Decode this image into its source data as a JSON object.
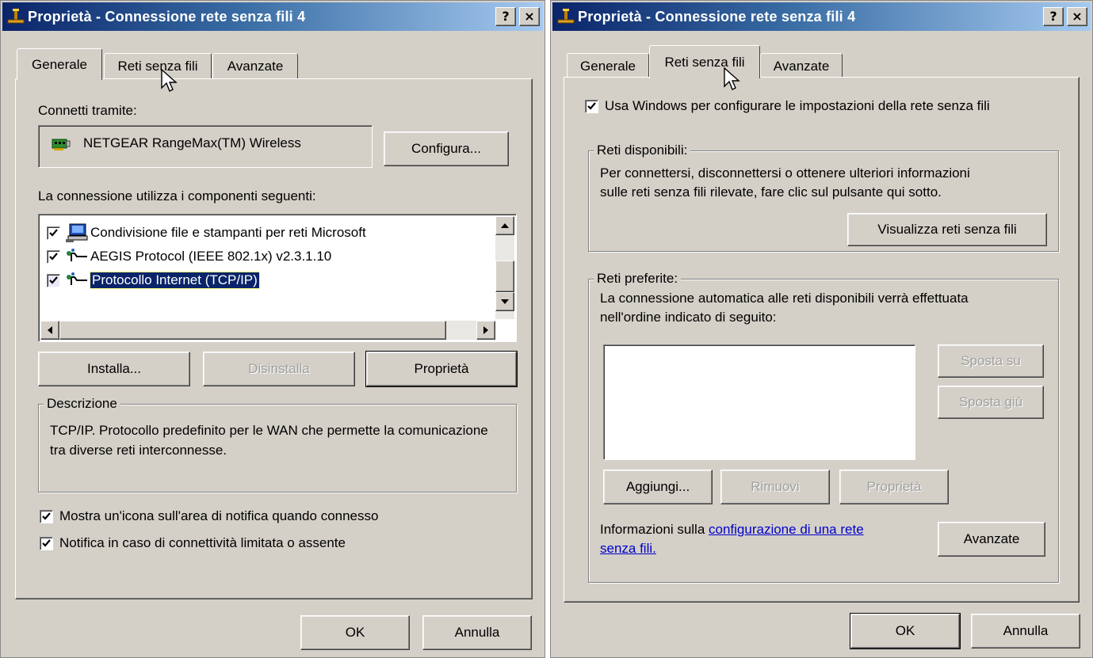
{
  "left_dialog": {
    "title": "Proprietà - Connessione rete senza fili 4",
    "help_button": "?",
    "close_button": "×",
    "tabs": [
      "Generale",
      "Reti senza fili",
      "Avanzate"
    ],
    "active_tab": "Generale",
    "connect_via_label": "Connetti tramite:",
    "adapter_name": "NETGEAR RangeMax(TM) Wireless",
    "configure_button": "Configura...",
    "components_label": "La connessione utilizza i componenti seguenti:",
    "components": [
      {
        "label": "Condivisione file e stampanti per reti Microsoft",
        "checked": true,
        "icon": "network-computer-icon"
      },
      {
        "label": "AEGIS Protocol (IEEE 802.1x) v2.3.1.10",
        "checked": true,
        "icon": "protocol-icon"
      },
      {
        "label": "Protocollo Internet (TCP/IP)",
        "checked": true,
        "icon": "protocol-icon",
        "selected": true
      }
    ],
    "install_button": "Installa...",
    "uninstall_button": "Disinstalla",
    "properties_button": "Proprietà",
    "description_legend": "Descrizione",
    "description_text": "TCP/IP. Protocollo predefinito per le WAN che permette la comunicazione tra diverse reti interconnesse.",
    "show_icon_label": "Mostra un'icona sull'area di notifica quando connesso",
    "show_icon_checked": true,
    "notify_label": "Notifica in caso di connettività limitata o assente",
    "notify_checked": true,
    "ok_button": "OK",
    "cancel_button": "Annulla"
  },
  "right_dialog": {
    "title": "Proprietà - Connessione rete senza fili 4",
    "help_button": "?",
    "close_button": "×",
    "tabs": [
      "Generale",
      "Reti senza fili",
      "Avanzate"
    ],
    "active_tab": "Reti senza fili",
    "use_windows_label": "Usa Windows per configurare le impostazioni della rete senza fili",
    "use_windows_checked": true,
    "available_legend": "Reti disponibili:",
    "available_text_1": "Per connettersi, disconnettersi o ottenere ulteriori informazioni",
    "available_text_2": "sulle reti senza fili rilevate, fare clic sul pulsante qui sotto.",
    "view_networks_button": "Visualizza reti senza fili",
    "preferred_legend": "Reti preferite:",
    "preferred_text_1": "La connessione automatica alle reti disponibili verrà effettuata",
    "preferred_text_2": "nell'ordine indicato di seguito:",
    "move_up_button": "Sposta su",
    "move_down_button": "Sposta giù",
    "add_button": "Aggiungi...",
    "remove_button": "Rimuovi",
    "properties_button": "Proprietà",
    "info_prefix": "Informazioni sulla ",
    "info_link_1": "configurazione di una rete",
    "info_link_2": "senza fili.",
    "advanced_button": "Avanzate",
    "ok_button": "OK",
    "cancel_button": "Annulla"
  },
  "colors": {
    "dialog_bg": "#d4d0c8",
    "title_start": "#0a246a",
    "title_end": "#a6caf0",
    "selection": "#0a246a",
    "link": "#0000cc"
  }
}
